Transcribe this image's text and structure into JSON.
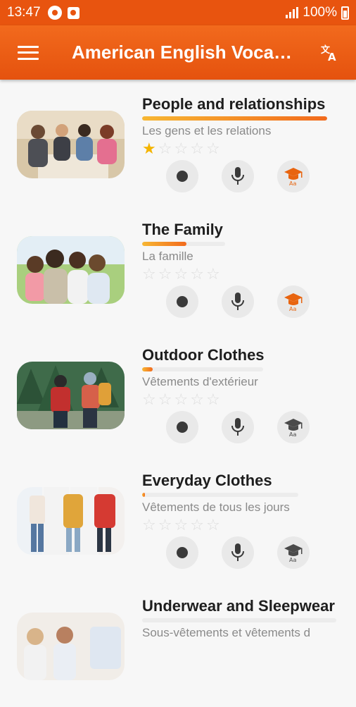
{
  "status_bar": {
    "time": "13:47",
    "battery": "100%"
  },
  "app_bar": {
    "title": "American English Voca…"
  },
  "colors": {
    "accent": "#e8540f",
    "star": "#f4b400",
    "cap_active": "#e8640f",
    "cap_inactive": "#4a4a4a"
  },
  "lessons": [
    {
      "title": "People and relationships",
      "subtitle": "Les gens et les relations",
      "progress": 1.0,
      "stars": 1,
      "learn_active": true
    },
    {
      "title": "The Family",
      "subtitle": "La famille",
      "progress": 0.53,
      "stars": 0,
      "learn_active": true
    },
    {
      "title": "Outdoor Clothes",
      "subtitle": "Vêtements d'extérieur",
      "progress": 0.09,
      "stars": 0,
      "learn_active": false
    },
    {
      "title": "Everyday Clothes",
      "subtitle": "Vêtements de tous les jours",
      "progress": 0.02,
      "stars": 0,
      "learn_active": false
    },
    {
      "title": "Underwear and Sleepwear",
      "subtitle": "Sous-vêtements et vêtements d",
      "progress": 0.0,
      "stars": 0,
      "learn_active": false
    }
  ]
}
